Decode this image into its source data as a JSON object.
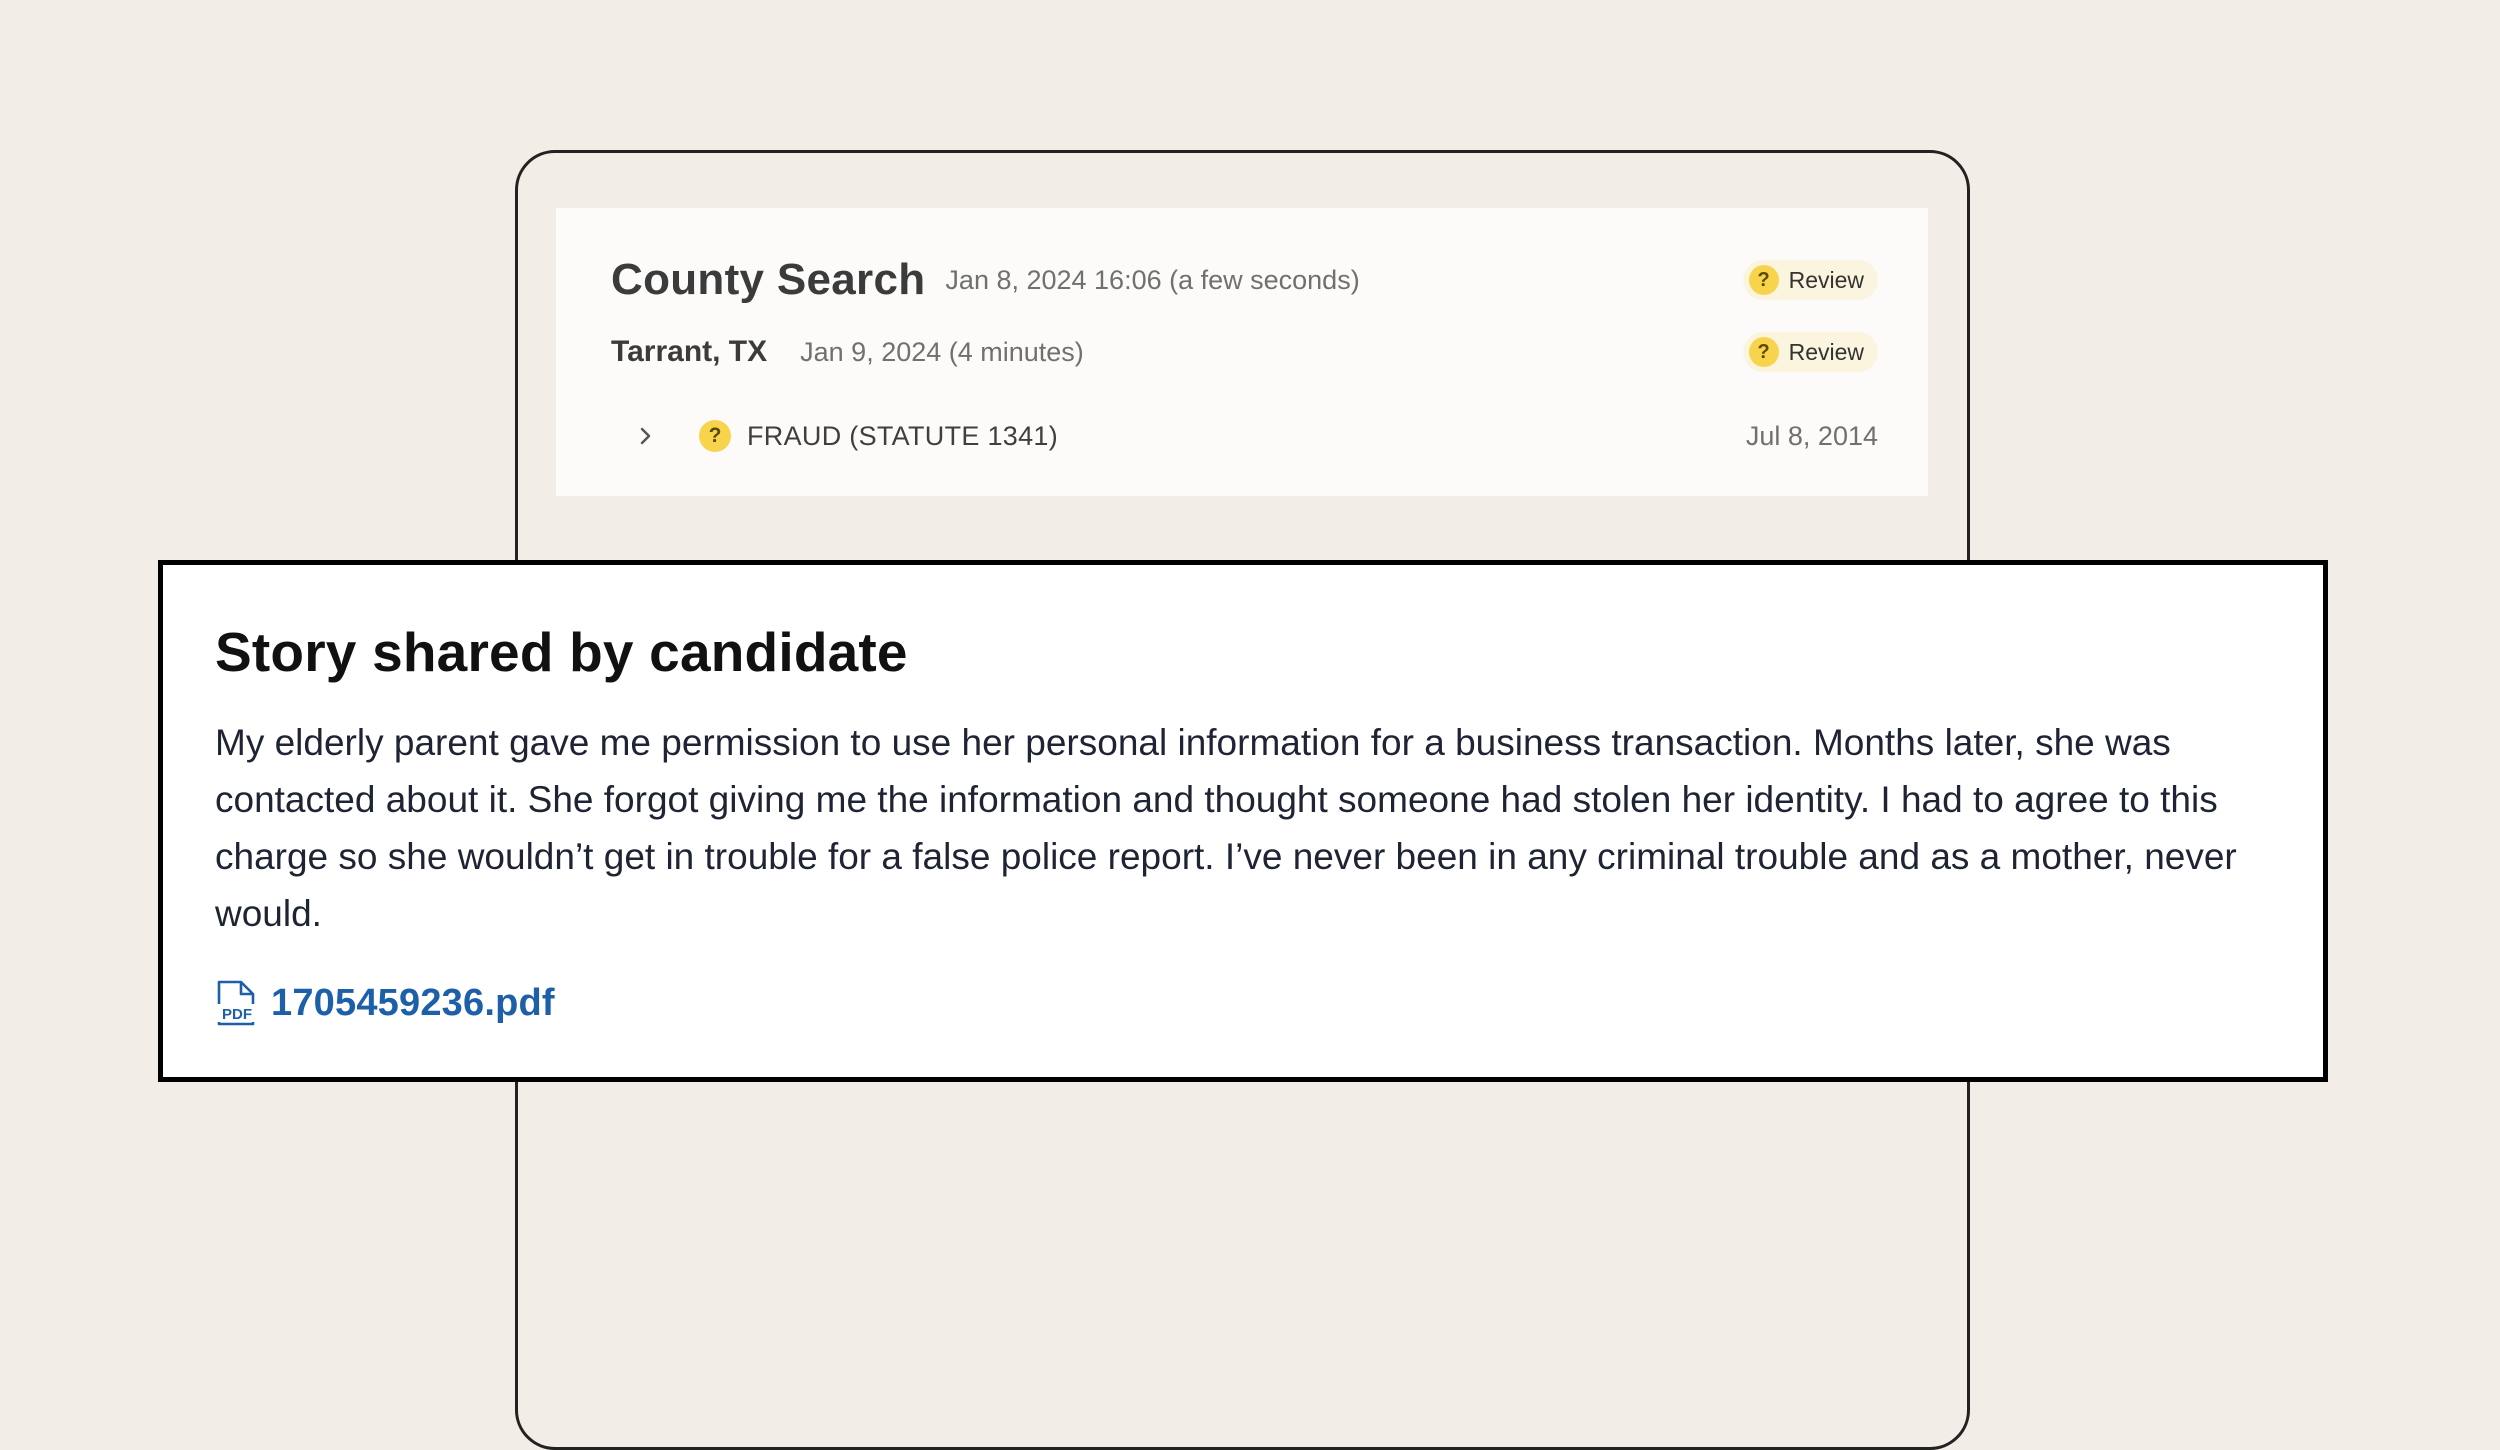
{
  "county_search": {
    "title": "County Search",
    "timestamp": "Jan 8, 2024 16:06 (a few seconds)",
    "status": "Review",
    "jurisdictions": [
      {
        "name": "Tarrant, TX",
        "timestamp": "Jan 9, 2024 (4 minutes)",
        "status": "Review",
        "charges": [
          {
            "label": "FRAUD (STATUTE 1341)",
            "date": "Jul 8, 2014"
          }
        ]
      }
    ]
  },
  "story": {
    "title": "Story shared by candidate",
    "body": "My elderly parent gave me permission to use her personal information for a business transaction. Months later, she was contacted about it. She forgot giving me the information and thought someone had stolen her identity. I had to agree to this charge so she wouldn’t get in trouble for a false police report. I’ve never been in any criminal trouble and as a mother, never would.",
    "attachment": "1705459236.pdf"
  },
  "icons": {
    "status": "question-icon",
    "expand": "chevron-right-icon",
    "attachment": "pdf-file-icon"
  },
  "colors": {
    "background": "#f2ede7",
    "review_badge": "#fbf5e0",
    "question_icon": "#f7d44c",
    "link": "#1d5fa8"
  }
}
